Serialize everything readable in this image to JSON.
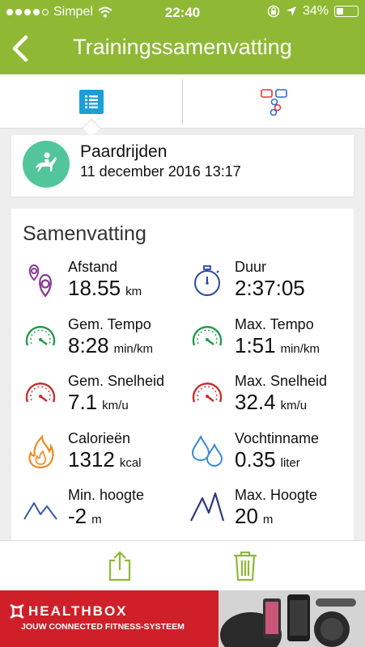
{
  "status_bar": {
    "carrier": "Simpel",
    "time": "22:40",
    "battery_percent": "34%",
    "battery_level": 0.34,
    "signal_dots_filled": 4
  },
  "navbar": {
    "title": "Trainingssamenvatting",
    "back_icon": "chevron-left-icon"
  },
  "tabs": [
    {
      "icon": "list-icon",
      "active": true
    },
    {
      "icon": "chat-bubbles-icon",
      "active": false
    }
  ],
  "activity": {
    "icon": "horse-riding-icon",
    "name": "Paardrijden",
    "date": "11 december 2016 13:17"
  },
  "summary": {
    "heading": "Samenvatting",
    "stats": [
      {
        "label": "Afstand",
        "value": "18.55",
        "unit": "km",
        "icon": "location-pins-icon"
      },
      {
        "label": "Duur",
        "value": "2:37:05",
        "unit": "",
        "icon": "stopwatch-icon"
      },
      {
        "label": "Gem. Tempo",
        "value": "8:28",
        "unit": "min/km",
        "icon": "speedometer-green-icon"
      },
      {
        "label": "Max. Tempo",
        "value": "1:51",
        "unit": "min/km",
        "icon": "speedometer-green-icon"
      },
      {
        "label": "Gem. Snelheid",
        "value": "7.1",
        "unit": "km/u",
        "icon": "speedometer-red-icon"
      },
      {
        "label": "Max. Snelheid",
        "value": "32.4",
        "unit": "km/u",
        "icon": "speedometer-red-icon"
      },
      {
        "label": "Calorieën",
        "value": "1312",
        "unit": "kcal",
        "icon": "flame-icon"
      },
      {
        "label": "Vochtinname",
        "value": "0.35",
        "unit": "liter",
        "icon": "water-drops-icon"
      },
      {
        "label": "Min. hoogte",
        "value": "-2",
        "unit": "m",
        "icon": "mountain-low-icon"
      },
      {
        "label": "Max. Hoogte",
        "value": "20",
        "unit": "m",
        "icon": "mountain-high-icon"
      }
    ]
  },
  "bottom_actions": [
    {
      "icon": "share-icon"
    },
    {
      "icon": "trash-icon"
    }
  ],
  "ad": {
    "brand": "HEALTHBOX",
    "tagline": "JOUW CONNECTED FITNESS-SYSTEEM",
    "background": "#cf202a"
  },
  "colors": {
    "accent": "#8fb934",
    "tab_active": "#1a9fd6",
    "activity_icon": "#52c59a",
    "green_gauge": "#1f9a4a",
    "red_gauge": "#cc2a2a",
    "blue": "#2b4aa0",
    "purple": "#8a3a8f",
    "orange": "#f08a1c"
  }
}
